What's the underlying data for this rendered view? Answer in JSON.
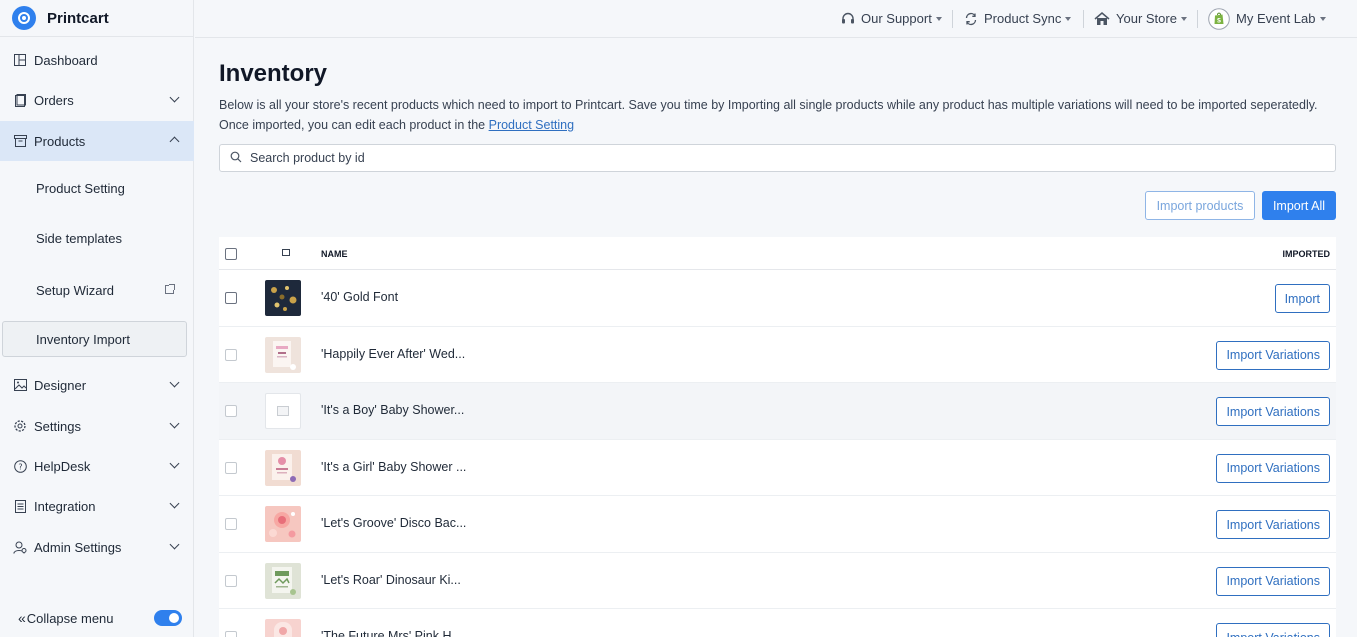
{
  "brand": {
    "name": "Printcart"
  },
  "sidebar": {
    "items": [
      {
        "label": "Dashboard",
        "icon": "dashboard-icon"
      },
      {
        "label": "Orders",
        "icon": "orders-icon"
      },
      {
        "label": "Products",
        "icon": "products-icon"
      },
      {
        "label": "Designer",
        "icon": "designer-icon"
      },
      {
        "label": "Settings",
        "icon": "gear-icon"
      },
      {
        "label": "HelpDesk",
        "icon": "help-icon"
      },
      {
        "label": "Integration",
        "icon": "integration-icon"
      },
      {
        "label": "Admin Settings",
        "icon": "admin-settings-icon"
      }
    ],
    "submenu": [
      {
        "label": "Product Setting"
      },
      {
        "label": "Side templates"
      },
      {
        "label": "Setup Wizard"
      },
      {
        "label": "Inventory Import"
      }
    ],
    "collapse_label": "Collapse menu"
  },
  "topbar": {
    "support": "Our Support",
    "sync": "Product Sync",
    "store": "Your Store",
    "account": "My Event Lab"
  },
  "page": {
    "title": "Inventory",
    "description": "Below is all your store's recent products which need to import to Printcart. Save you time by Importing all single products while any product has multiple variations will need to be imported seperatedly. Once imported, you can edit each product in the ",
    "description_link": "Product Setting",
    "search_placeholder": "Search product by id",
    "import_products_label": "Import products",
    "import_all_label": "Import All"
  },
  "table": {
    "headers": {
      "name": "NAME",
      "imported": "IMPORTED"
    },
    "rows": [
      {
        "name": "'40' Gold Font",
        "action": "Import",
        "thumb_color": "#1e293b",
        "thumb_accent": "#c9a24a"
      },
      {
        "name": "'Happily Ever After' Wed...",
        "action": "Import Variations",
        "thumb_color": "#efe3dc",
        "thumb_accent": "#e8a9c3"
      },
      {
        "name": "'It's a Boy' Baby Shower...",
        "action": "Import Variations",
        "thumb_color": "#ffffff",
        "thumb_accent": "#d1d5db"
      },
      {
        "name": "'It's a Girl' Baby Shower ...",
        "action": "Import Variations",
        "thumb_color": "#f1dcd2",
        "thumb_accent": "#e58fa8"
      },
      {
        "name": "'Let's Groove' Disco Bac...",
        "action": "Import Variations",
        "thumb_color": "#f6c7c0",
        "thumb_accent": "#e86f7a"
      },
      {
        "name": "'Let's Roar' Dinosaur Ki...",
        "action": "Import Variations",
        "thumb_color": "#dfe3d6",
        "thumb_accent": "#6f9a5d"
      },
      {
        "name": "'The Future Mrs' Pink H...",
        "action": "Import Variations",
        "thumb_color": "#f7d3cf",
        "thumb_accent": "#f0a7a8"
      }
    ]
  }
}
